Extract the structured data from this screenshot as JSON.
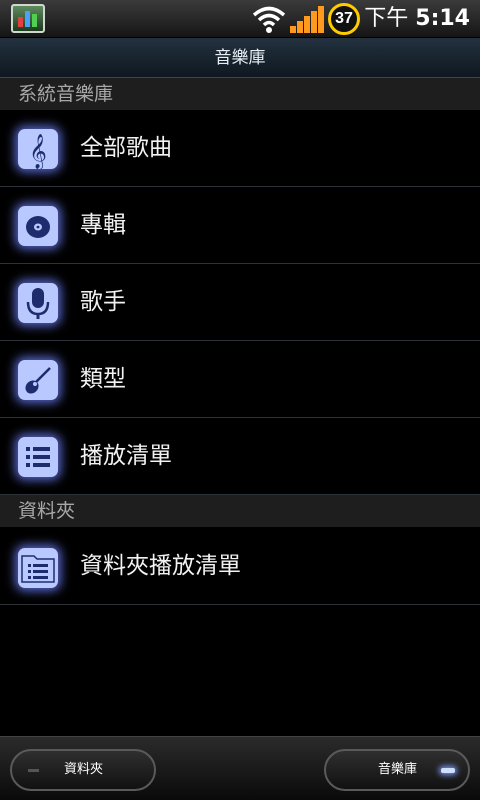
{
  "status_bar": {
    "battery_level": "37",
    "time_period": "下午",
    "time": "5:14",
    "icons": [
      "app-notification-icon",
      "wifi-icon",
      "signal-icon",
      "battery-icon"
    ]
  },
  "title_bar": {
    "title": "音樂庫"
  },
  "sections": [
    {
      "header": "系統音樂庫",
      "items": [
        {
          "label": "全部歌曲",
          "icon": "treble-clef-icon"
        },
        {
          "label": "專輯",
          "icon": "album-disc-icon"
        },
        {
          "label": "歌手",
          "icon": "microphone-icon"
        },
        {
          "label": "類型",
          "icon": "guitar-icon"
        },
        {
          "label": "播放清單",
          "icon": "playlist-icon"
        }
      ]
    },
    {
      "header": "資料夾",
      "items": [
        {
          "label": "資料夾播放清單",
          "icon": "folder-playlist-icon"
        }
      ]
    }
  ],
  "bottom_bar": {
    "left_tab": "資料夾",
    "right_tab": "音樂庫",
    "active_tab": "音樂庫"
  },
  "colors": {
    "icon_fill": "#b9c9ff",
    "icon_glow": "#6e82ff",
    "battery_ring": "#ffcc00",
    "signal": "#ff9a1f"
  }
}
